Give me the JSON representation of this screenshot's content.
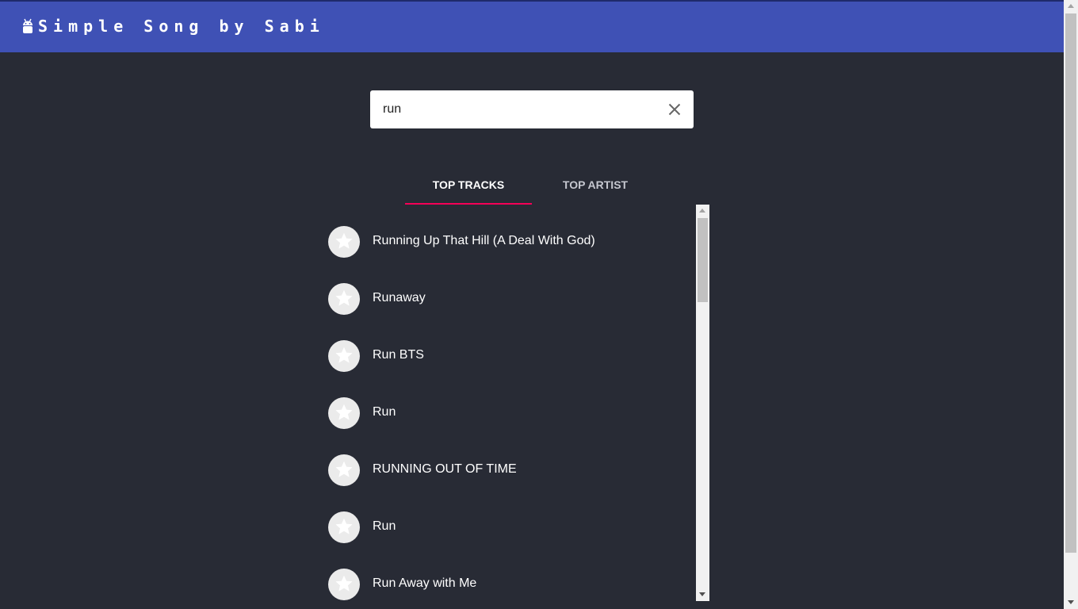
{
  "header": {
    "title": "Simple Song by Sabi",
    "logo_icon": "android-icon",
    "background": "#3f51b5"
  },
  "search": {
    "value": "run",
    "clear_icon": "close-icon"
  },
  "tabs": [
    {
      "label": "TOP TRACKS",
      "active": true
    },
    {
      "label": "TOP ARTIST",
      "active": false
    }
  ],
  "accent_color": "#f50057",
  "tracks": [
    {
      "title": "Running Up That Hill (A Deal With God)",
      "icon": "star-icon"
    },
    {
      "title": "Runaway",
      "icon": "star-icon"
    },
    {
      "title": "Run BTS",
      "icon": "star-icon"
    },
    {
      "title": "Run",
      "icon": "star-icon"
    },
    {
      "title": "RUNNING OUT OF TIME",
      "icon": "star-icon"
    },
    {
      "title": "Run",
      "icon": "star-icon"
    },
    {
      "title": "Run Away with Me",
      "icon": "star-icon"
    }
  ]
}
